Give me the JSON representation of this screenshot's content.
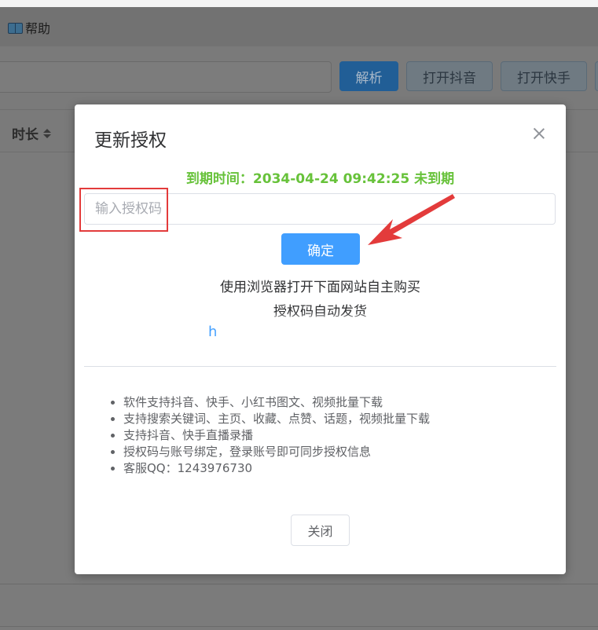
{
  "menubar": {
    "help_label": "帮助"
  },
  "toolbar": {
    "url_placeholder": "",
    "parse_label": "解析",
    "open_douyin_label": "打开抖音",
    "open_kuaishou_label": "打开快手"
  },
  "table": {
    "col_duration": "时长"
  },
  "dialog": {
    "title": "更新授权",
    "expire_text": "到期时间：2034-04-24 09:42:25 未到期",
    "auth_placeholder": "输入授权码",
    "confirm_label": "确定",
    "buy_line1": "使用浏览器打开下面网站自主购买",
    "buy_line2": "授权码自动发货",
    "link_text": "h",
    "features": [
      "软件支持抖音、快手、小红书图文、视频批量下载",
      "支持搜索关键词、主页、收藏、点赞、话题，视频批量下载",
      "支持抖音、快手直播录播",
      "授权码与账号绑定，登录账号即可同步授权信息",
      "客服QQ：1243976730"
    ],
    "close_label": "关闭"
  },
  "colors": {
    "primary": "#409eff",
    "success": "#67c23a",
    "annotation_red": "#e33b3b"
  }
}
